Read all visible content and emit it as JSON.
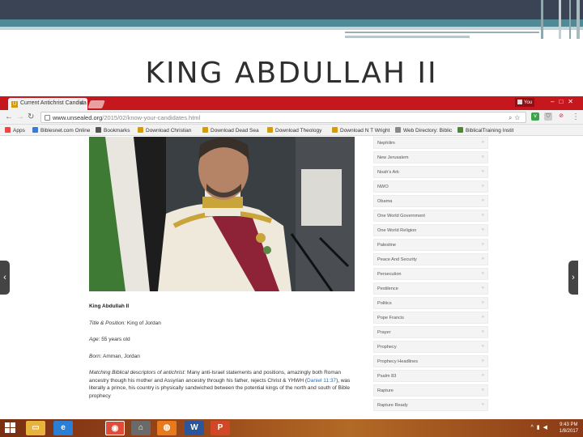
{
  "slide": {
    "title": "KING ABDULLAH II"
  },
  "browser": {
    "tab_title": "Current Antichrist Candida",
    "tab_favicon": "U",
    "profile_label": "You",
    "url_host": "www.unsealed.org",
    "url_path": "/2015/02/know-your-candidates.html",
    "bookmarks": [
      {
        "label": "Apps",
        "icon": "apps-grid-icon",
        "color": "#e44"
      },
      {
        "label": "Biblesnet.com Online",
        "icon": "biblesnet-icon",
        "color": "#3a7bd5"
      },
      {
        "label": "Bookmarks",
        "icon": "star-icon",
        "color": "#555"
      },
      {
        "label": "Download Christian",
        "icon": "shield-bookmark-icon",
        "color": "#d59b00"
      },
      {
        "label": "Download Dead Sea",
        "icon": "shield-bookmark-icon",
        "color": "#d59b00"
      },
      {
        "label": "Download Theology",
        "icon": "shield-bookmark-icon",
        "color": "#d59b00"
      },
      {
        "label": "Download N T Wright",
        "icon": "shield-bookmark-icon",
        "color": "#d59b00"
      },
      {
        "label": "Web Directory: Biblic",
        "icon": "page-icon",
        "color": "#888"
      },
      {
        "label": "BiblicalTraining Instit",
        "icon": "tree-icon",
        "color": "#4a8a2a"
      }
    ]
  },
  "article": {
    "name": "King Abdullah II",
    "title_position_label": "Title & Position:",
    "title_position_value": "King of Jordan",
    "age_label": "Age:",
    "age_value": "55 years old",
    "born_label": "Born:",
    "born_value": "Amman, Jordan",
    "descriptors_label": "Matching Biblical descriptors of antichrist:",
    "descriptors_text_1": "Many anti-Israel statements and positions, amazingly both Roman ancestry though his mother and Assyrian ancestry through his father, rejects Christ & YHWH (",
    "descriptors_ref": "Daniel 11:37",
    "descriptors_text_2": "), was literally a prince, his country is physically sandwiched between the potential kings of the north and south of Bible prophecy"
  },
  "sidebar": {
    "items": [
      "Nephilim",
      "New Jerusalem",
      "Noah's Ark",
      "NWO",
      "Obama",
      "One World Government",
      "One World Religion",
      "Palestine",
      "Peace And Security",
      "Persecution",
      "Pestilence",
      "Politics",
      "Pope Francis",
      "Prayer",
      "Prophecy",
      "Prophecy Headlines",
      "Psalm 83",
      "Rapture",
      "Rapture Ready"
    ]
  },
  "taskbar": {
    "time": "9:43 PM",
    "date": "1/8/2017",
    "apps": [
      {
        "name": "file-explorer-icon",
        "color": "#e8b33a",
        "glyph": "▭"
      },
      {
        "name": "internet-explorer-icon",
        "color": "#2a7fd5",
        "glyph": "e"
      },
      {
        "name": "chrome-icon",
        "color": "#e04b3a",
        "glyph": "◉"
      },
      {
        "name": "home-icon",
        "color": "#6a6a6a",
        "glyph": "⌂"
      },
      {
        "name": "firefox-icon",
        "color": "#e87a1e",
        "glyph": "◍"
      },
      {
        "name": "word-icon",
        "color": "#2b579a",
        "glyph": "W"
      },
      {
        "name": "powerpoint-icon",
        "color": "#d24726",
        "glyph": "P"
      }
    ]
  }
}
